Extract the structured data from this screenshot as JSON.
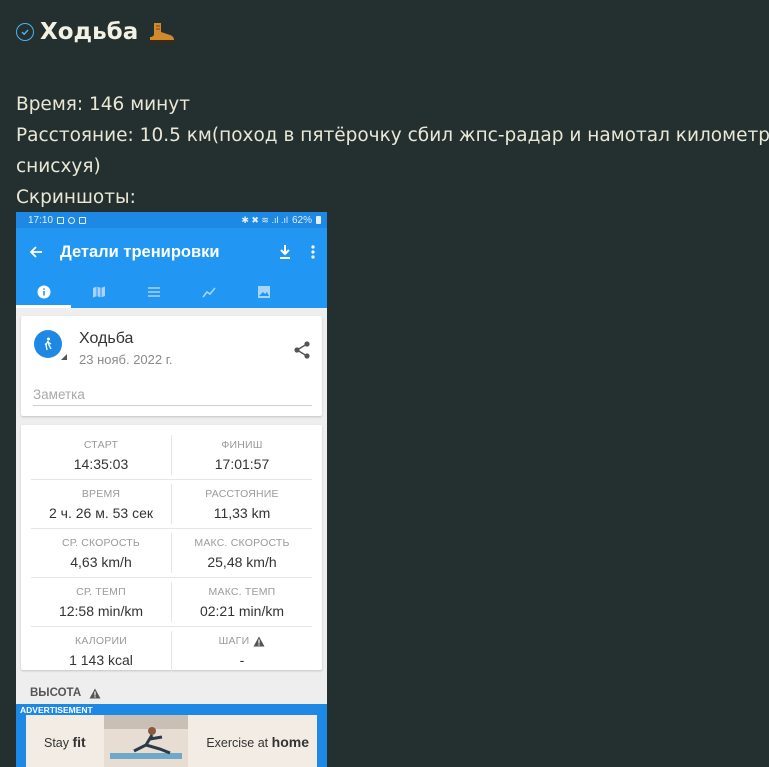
{
  "post": {
    "title": "Ходьба",
    "lines": [
      "Время: 146 минут",
      "Расстояние: 10.5 км(поход в пятёрочку сбил жпс-радар и намотал километр",
      "снисхуя)",
      "Скриншоты:"
    ]
  },
  "phone": {
    "status": {
      "time": "17:10",
      "battery": "62%"
    },
    "app_bar": {
      "title": "Детали тренировки"
    },
    "tabs": [
      "info-icon",
      "map-icon",
      "list-icon",
      "chart-icon",
      "image-icon"
    ],
    "activity": {
      "name": "Ходьба",
      "date": "23 нояб. 2022 г.",
      "note_placeholder": "Заметка"
    },
    "stats": {
      "start_label": "СТАРТ",
      "start_value": "14:35:03",
      "finish_label": "ФИНИШ",
      "finish_value": "17:01:57",
      "time_label": "ВРЕМЯ",
      "time_value": "2 ч. 26 м. 53 сек",
      "distance_label": "РАССТОЯНИЕ",
      "distance_value": "11,33 km",
      "avg_speed_label": "СР. СКОРОСТЬ",
      "avg_speed_value": "4,63 km/h",
      "max_speed_label": "МАКС. СКОРОСТЬ",
      "max_speed_value": "25,48 km/h",
      "avg_pace_label": "СР. ТЕМП",
      "avg_pace_value": "12:58 min/km",
      "max_pace_label": "МАКС. ТЕМП",
      "max_pace_value": "02:21 min/km",
      "calories_label": "КАЛОРИИ",
      "calories_value": "1 143 kcal",
      "steps_label": "ШАГИ",
      "steps_value": "-"
    },
    "altitude_label": "ВЫСОТА",
    "ad": {
      "label": "ADVERTISEMENT",
      "left_prefix": "Stay",
      "left_bold": "fit",
      "right_prefix": "Exercise at",
      "right_bold": "home"
    }
  },
  "colors": {
    "background": "#23302f",
    "text": "#eae7d6",
    "accent_blue": "#2196f3",
    "status_blue": "#1e88e5"
  }
}
